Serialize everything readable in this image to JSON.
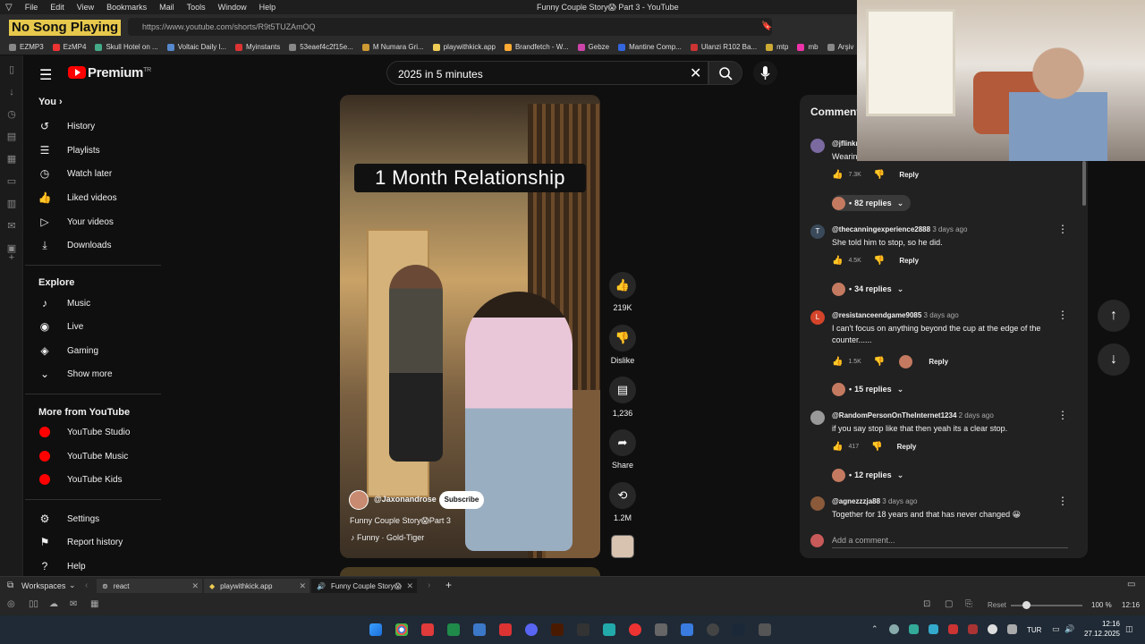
{
  "os_menu": {
    "items": [
      "File",
      "Edit",
      "View",
      "Bookmarks",
      "Mail",
      "Tools",
      "Window",
      "Help"
    ],
    "window_title": "Funny Couple Story😱 Part 3 - YouTube"
  },
  "overlay": {
    "now_playing": "No Song Playing"
  },
  "browser": {
    "url": "https://www.youtube.com/shorts/R9t5TUZAmOQ",
    "bookmarks": [
      "EZMP3",
      "EzMP4",
      "Skull Hotel on ...",
      "Voltaic Daily l...",
      "Myinstants",
      "53eaef4c2f15e...",
      "M Numara Gri...",
      "playwithkick.app",
      "Brandfetch - W...",
      "Gebze",
      "Mantine Comp...",
      "Ulanzi R102 Ba...",
      "mtp",
      "mb",
      "Arşiv"
    ]
  },
  "youtube": {
    "brand": "Premium",
    "brand_sup": "TR",
    "search_value": "2025 in 5 minutes"
  },
  "guide": {
    "you_label": "You",
    "you_items": [
      "History",
      "Playlists",
      "Watch later",
      "Liked videos",
      "Your videos",
      "Downloads"
    ],
    "explore_label": "Explore",
    "explore_items": [
      "Music",
      "Live",
      "Gaming",
      "Show more"
    ],
    "more_label": "More from YouTube",
    "more_items": [
      "YouTube Studio",
      "YouTube Music",
      "YouTube Kids"
    ],
    "settings_items": [
      "Settings",
      "Report history",
      "Help"
    ]
  },
  "short": {
    "caption": "1 Month Relationship",
    "handle": "@Jaxonandrose",
    "subscribe": "Subscribe",
    "title": "Funny Couple Story😱Part 3",
    "music": "Funny · Gold-Tiger",
    "likes": "219K",
    "dislike": "Dislike",
    "comments": "1,236",
    "share": "Share",
    "remix": "1.2M"
  },
  "comments": {
    "title": "Comments",
    "add_placeholder": "Add a comment...",
    "list": [
      {
        "user": "@jflinkr",
        "age": "",
        "text": "Wearin",
        "likes": "7.3K",
        "reply": "Reply",
        "replies": "82 replies"
      },
      {
        "user": "@thecanningexperience2888",
        "age": "3 days ago",
        "text": "She told him to stop, so he did.",
        "likes": "4.5K",
        "reply": "Reply",
        "replies": "34 replies"
      },
      {
        "user": "@resistanceendgame9085",
        "age": "3 days ago",
        "text": "I can't focus on anything beyond the cup at the edge of the counter......",
        "likes": "1.5K",
        "reply": "Reply",
        "replies": "15 replies"
      },
      {
        "user": "@RandomPersonOnTheInternet1234",
        "age": "2 days ago",
        "text": "if you say stop like that then yeah its a clear stop.",
        "likes": "417",
        "reply": "Reply",
        "replies": "12 replies"
      },
      {
        "user": "@agnezzzja88",
        "age": "3 days ago",
        "text": "Together for 18 years and that has never changed 😀",
        "likes": "",
        "reply": "",
        "replies": ""
      }
    ]
  },
  "vivaldi": {
    "workspaces": "Workspaces",
    "tabs": [
      "react",
      "playwithkick.app",
      "Funny Couple Story😱"
    ],
    "reset": "Reset",
    "zoom": "100 %",
    "time": "12:16"
  },
  "taskbar": {
    "lang": "TUR",
    "time": "12:16",
    "date": "27.12.2025"
  }
}
